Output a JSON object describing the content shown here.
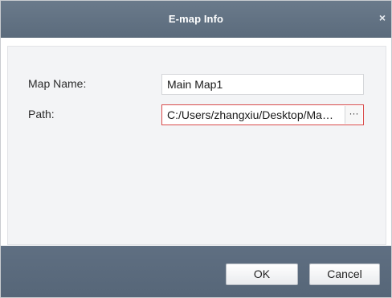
{
  "dialog": {
    "title": "E-map Info",
    "close_glyph": "×"
  },
  "form": {
    "map_name_label": "Map Name:",
    "map_name_value": "Main Map1",
    "path_label": "Path:",
    "path_value": "C:/Users/zhangxiu/Desktop/Ma…",
    "browse_glyph": "···"
  },
  "buttons": {
    "ok_label": "OK",
    "cancel_label": "Cancel"
  }
}
